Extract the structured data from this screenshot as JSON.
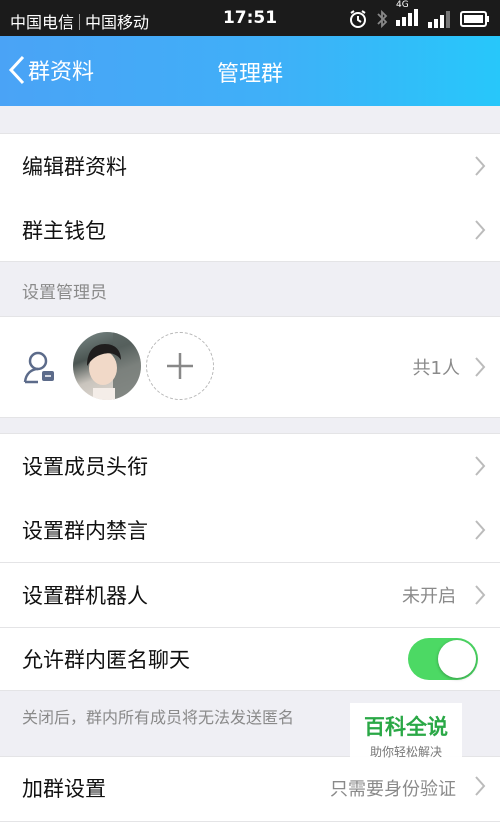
{
  "status_bar": {
    "carrier1": "中国电信",
    "carrier2": "中国移动",
    "time": "17:51",
    "network": "4G"
  },
  "nav": {
    "back_label": "群资料",
    "title": "管理群"
  },
  "group1": {
    "edit_profile": "编辑群资料",
    "wallet": "群主钱包"
  },
  "admins": {
    "section_title": "设置管理员",
    "count": "共1人"
  },
  "group2": {
    "member_title": "设置成员头衔",
    "mute": "设置群内禁言",
    "robot": "设置群机器人",
    "robot_status": "未开启",
    "anonymous": "允许群内匿名聊天",
    "anonymous_enabled": true
  },
  "note": "关闭后，群内所有成员将无法发送匿名",
  "join": {
    "label": "加群设置",
    "value": "只需要身份验证"
  },
  "watermark": {
    "title": "百科全说",
    "subtitle": "助你轻松解决"
  },
  "colors": {
    "nav_start": "#4aa3f6",
    "nav_end": "#27c7fa",
    "toggle_on": "#4cd964",
    "watermark_green": "#2aa846"
  }
}
